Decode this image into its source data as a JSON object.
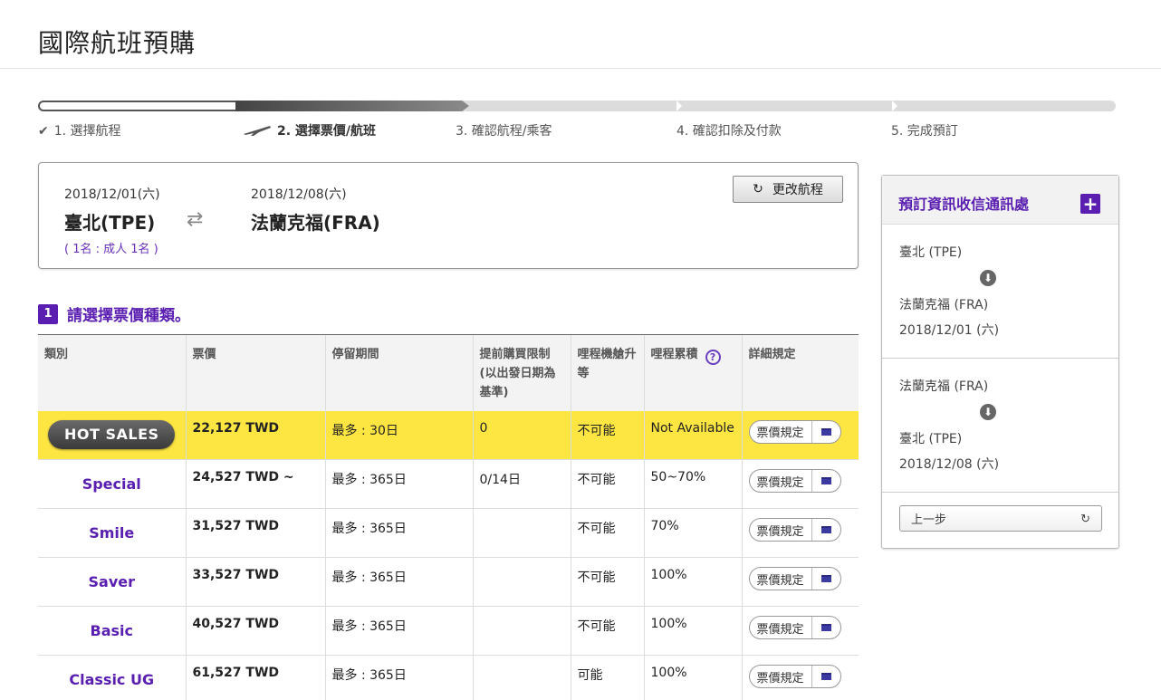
{
  "page": {
    "title": "國際航班預購"
  },
  "steps": [
    {
      "label": "1. 選擇航程",
      "icon": "checkmark-icon"
    },
    {
      "label": "2. 選擇票價/航班",
      "icon": "airplane-icon"
    },
    {
      "label": "3. 確認航程/乘客"
    },
    {
      "label": "4. 確認扣除及付款"
    },
    {
      "label": "5. 完成預訂"
    }
  ],
  "itinerary": {
    "depart_date": "2018/12/01(六)",
    "depart_city": "臺北(TPE)",
    "return_date": "2018/12/08(六)",
    "return_city": "法蘭克福(FRA)",
    "passengers": "( 1名 : 成人 1名 )",
    "change_label": "更改航程"
  },
  "section": {
    "number": "1",
    "title": "請選擇票價種類。"
  },
  "fare_table": {
    "headers": [
      "類別",
      "票價",
      "停留期間",
      "提前購買限制 (以出發日期為基準)",
      "哩程機艙升等",
      "哩程累積",
      "詳細規定"
    ],
    "rule_label": "票價規定",
    "rows": [
      {
        "type": "HOT SALES",
        "price": "22,127 TWD",
        "stay": "最多 : 30日",
        "advance": "0",
        "upgrade": "不可能",
        "mileage": "Not Available"
      },
      {
        "type": "Special",
        "price": "24,527 TWD ~",
        "stay": "最多 : 365日",
        "advance": "0/14日",
        "upgrade": "不可能",
        "mileage": "50~70%"
      },
      {
        "type": "Smile",
        "price": "31,527 TWD",
        "stay": "最多 : 365日",
        "advance": "",
        "upgrade": "不可能",
        "mileage": "70%"
      },
      {
        "type": "Saver",
        "price": "33,527 TWD",
        "stay": "最多 : 365日",
        "advance": "",
        "upgrade": "不可能",
        "mileage": "100%"
      },
      {
        "type": "Basic",
        "price": "40,527 TWD",
        "stay": "最多 : 365日",
        "advance": "",
        "upgrade": "不可能",
        "mileage": "100%"
      },
      {
        "type": "Classic UG",
        "price": "61,527 TWD",
        "stay": "最多 : 365日",
        "advance": "",
        "upgrade": "可能",
        "mileage": "100%"
      }
    ]
  },
  "side_panel": {
    "title": "預訂資訊收信通訊處",
    "segments": [
      {
        "from": "臺北 (TPE)",
        "to": "法蘭克福 (FRA)",
        "date": "2018/12/01 (六)"
      },
      {
        "from": "法蘭克福 (FRA)",
        "to": "臺北 (TPE)",
        "date": "2018/12/08 (六)"
      }
    ],
    "prev_label": "上一步"
  },
  "colors": {
    "accent": "#5a1fb0",
    "hot_row": "#fde542"
  }
}
